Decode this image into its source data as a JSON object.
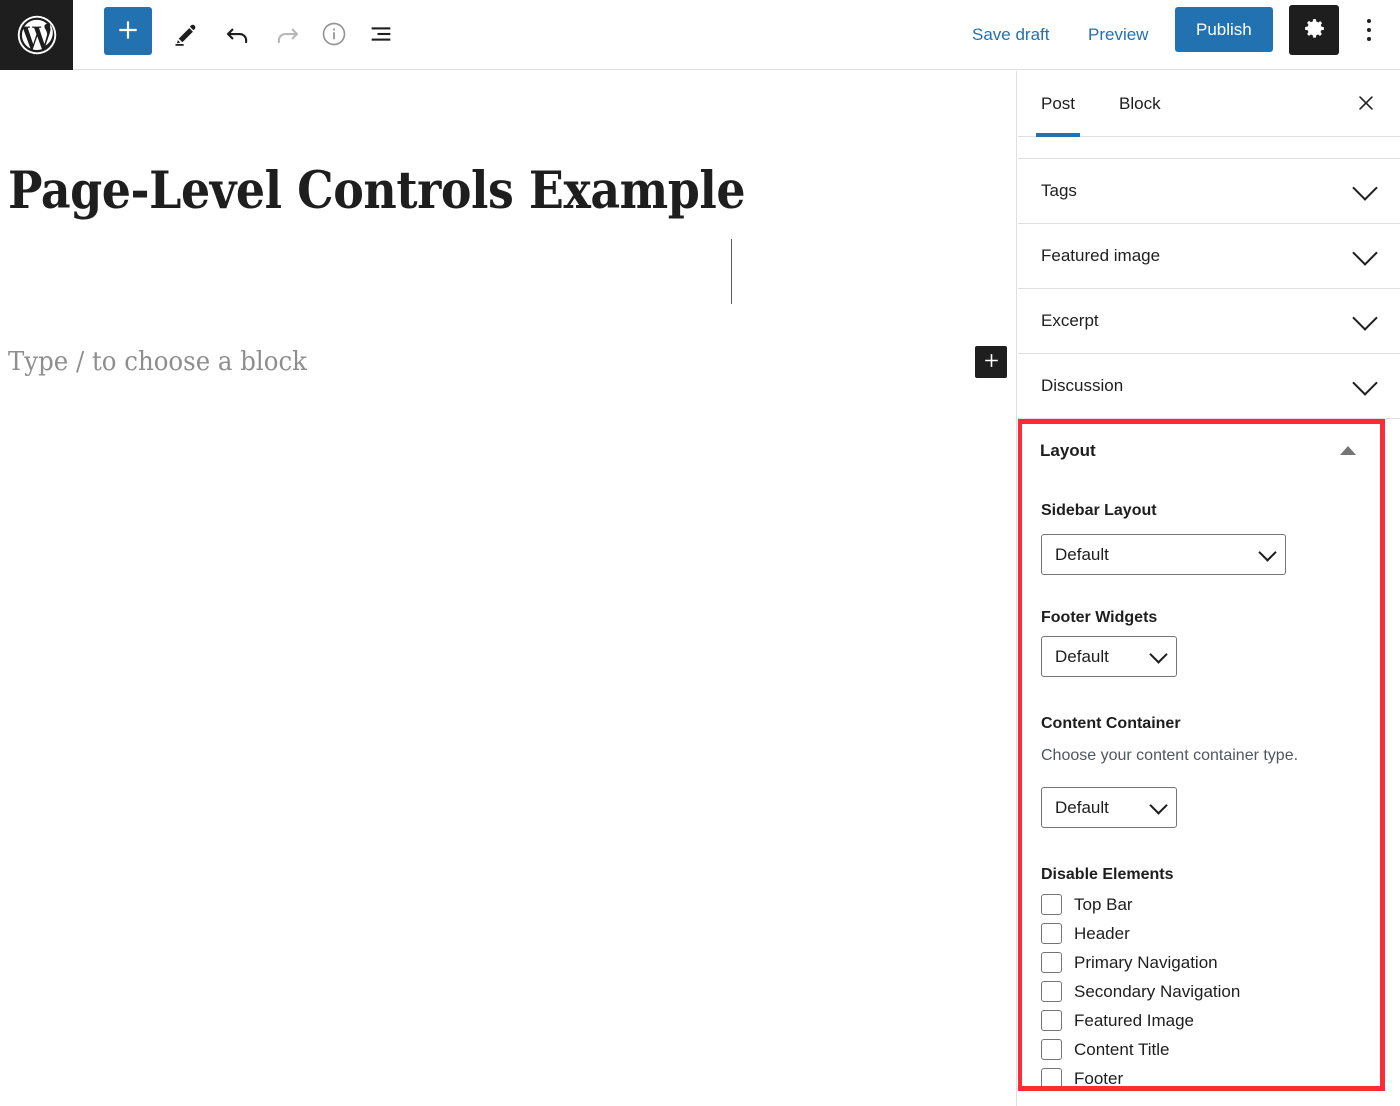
{
  "topbar": {
    "logo_icon": "wordpress-logo-icon",
    "add_block_icon": "plus-icon",
    "edit_mode_icon": "pencil-icon",
    "undo_icon": "undo-arrow-icon",
    "redo_icon": "redo-arrow-icon",
    "info_icon": "info-circle-icon",
    "list_view_icon": "list-view-icon",
    "save_draft_label": "Save draft",
    "preview_label": "Preview",
    "publish_label": "Publish",
    "settings_icon": "gear-icon",
    "more_icon": "kebab-menu-icon"
  },
  "editor": {
    "post_title": "Page-Level Controls Example",
    "block_placeholder": "Type / to choose a block",
    "inline_inserter_icon": "plus-icon"
  },
  "sidebar": {
    "tabs": [
      {
        "label": "Post",
        "active": true
      },
      {
        "label": "Block",
        "active": false
      }
    ],
    "close_icon": "close-icon",
    "panels": [
      {
        "label": "Tags",
        "expanded": false
      },
      {
        "label": "Featured image",
        "expanded": false
      },
      {
        "label": "Excerpt",
        "expanded": false
      },
      {
        "label": "Discussion",
        "expanded": false
      }
    ],
    "layout_panel": {
      "title": "Layout",
      "expanded": true,
      "collapse_icon": "triangle-up-icon",
      "highlight_color": "#fb2c36",
      "fields": [
        {
          "label": "Sidebar Layout",
          "help": "",
          "value": "Default"
        },
        {
          "label": "Footer Widgets",
          "help": "",
          "value": "Default"
        },
        {
          "label": "Content Container",
          "help": "Choose your content container type.",
          "value": "Default"
        }
      ],
      "disable_elements": {
        "label": "Disable Elements",
        "items": [
          {
            "label": "Top Bar",
            "checked": false
          },
          {
            "label": "Header",
            "checked": false
          },
          {
            "label": "Primary Navigation",
            "checked": false
          },
          {
            "label": "Secondary Navigation",
            "checked": false
          },
          {
            "label": "Featured Image",
            "checked": false
          },
          {
            "label": "Content Title",
            "checked": false
          },
          {
            "label": "Footer",
            "checked": false
          }
        ]
      }
    }
  },
  "colors": {
    "accent_blue": "#2271b1",
    "dark": "#1e1e1e",
    "highlight_red": "#fb2c36"
  }
}
